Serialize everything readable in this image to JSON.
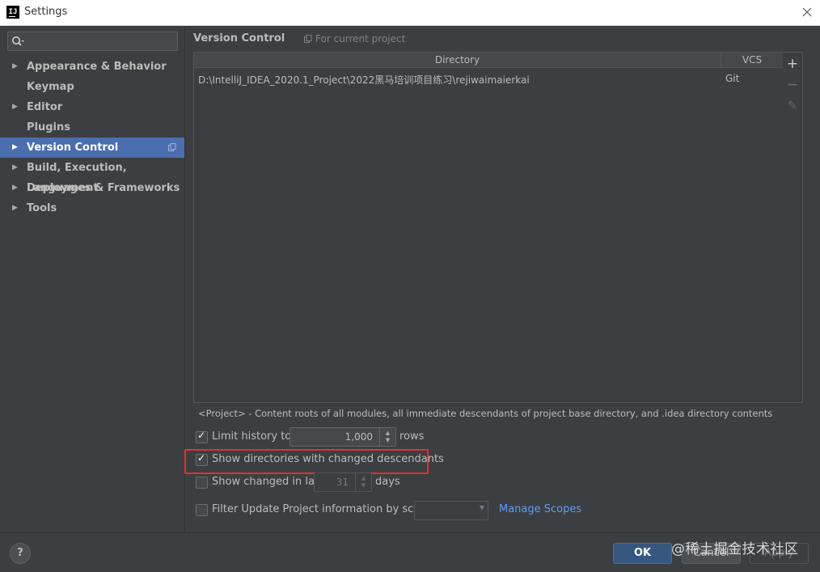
{
  "window": {
    "title": "Settings",
    "app_icon_text": "IJ"
  },
  "sidebar": {
    "search": {
      "value": "",
      "placeholder": ""
    },
    "items": [
      {
        "label": "Appearance & Behavior",
        "has_children": true,
        "selected": false
      },
      {
        "label": "Keymap",
        "has_children": false,
        "selected": false
      },
      {
        "label": "Editor",
        "has_children": true,
        "selected": false
      },
      {
        "label": "Plugins",
        "has_children": false,
        "selected": false
      },
      {
        "label": "Version Control",
        "has_children": true,
        "selected": true
      },
      {
        "label": "Build, Execution, Deployment",
        "has_children": true,
        "selected": false
      },
      {
        "label": "Languages & Frameworks",
        "has_children": true,
        "selected": false
      },
      {
        "label": "Tools",
        "has_children": true,
        "selected": false
      }
    ]
  },
  "main": {
    "title": "Version Control",
    "scope_hint": "For current project",
    "table": {
      "columns": [
        "Directory",
        "VCS"
      ],
      "rows": [
        {
          "directory": "D:\\IntelliJ_IDEA_2020.1_Project\\2022黑马培训项目练习\\rejiwaimaierkai",
          "vcs": "Git"
        }
      ]
    },
    "toolbar": {
      "add": "+",
      "remove": "−",
      "edit": "✎"
    },
    "description": "<Project> - Content roots of all modules, all immediate descendants of project base directory, and .idea directory contents",
    "options": {
      "limit_history": {
        "label": "Limit history to:",
        "checked": true,
        "value": "1,000",
        "suffix": "rows"
      },
      "show_dirs": {
        "label": "Show directories with changed descendants",
        "checked": true
      },
      "show_changed": {
        "label": "Show changed in last",
        "checked": false,
        "value": "31",
        "suffix": "days"
      },
      "filter_update": {
        "label": "Filter Update Project information by scope",
        "checked": false,
        "dropdown_value": ""
      },
      "manage_scopes": "Manage Scopes"
    }
  },
  "footer": {
    "help": "?",
    "ok": "OK",
    "cancel": "Cancel",
    "apply": "Apply",
    "watermark": "@稀土掘金技术社区"
  },
  "colors": {
    "accent_selected": "#4b6eaf",
    "link": "#589df6",
    "highlight_box": "#e0322b",
    "ok_button": "#365880"
  }
}
